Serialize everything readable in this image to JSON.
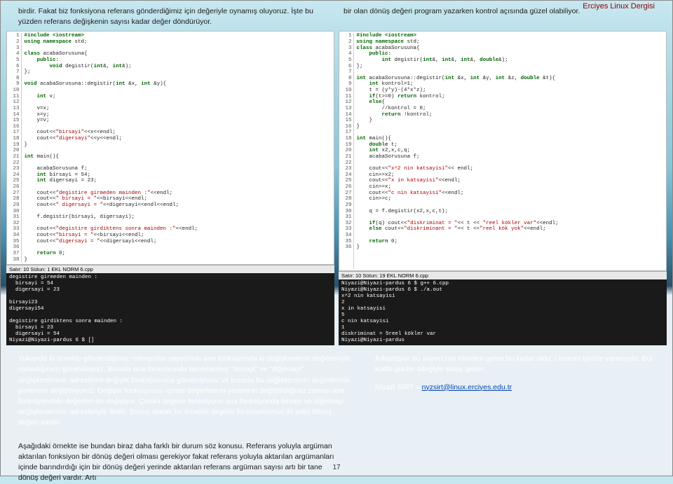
{
  "header": {
    "journal": "Erciyes Linux Dergisi"
  },
  "intro": {
    "left": "birdir. Fakat biz fonksiyona referans gönderdiğimiz için değeriyle oynamış oluyoruz. İşte bu yüzden referans değişkenin sayısı kadar değer döndürüyor.",
    "right": "bir olan dönüş değeri program yazarken kontrol açısında güzel olabiliyor."
  },
  "code_left": {
    "lines": 38,
    "status": "Satır: 10 Sütun: 1    EKL   NORM   6.cpp",
    "terminal": "degistire girmeden mainden :\n  birsayi = 54\n  digersayi = 23\n\nbirsayi23\ndigersayi54\n\ndegistire girdiktens sonra mainden :\n  birsayi = 23\n  digersayi = 54\nNiyazi@Niyazi-pardus 6 $ []"
  },
  "code_right": {
    "lines": 36,
    "status": "Satır: 10 Sütun: 19    EKL   NORM   6.cpp",
    "terminal": "Niyazi@Niyazi-pardus 6 $ g++ 6.cpp\nNiyazi@Niyazi-pardus 6 $ ./a.out\nx^2 nin katsayisi\n2\nx in katsayisi\n5\nc nin katsayisi\n1\ndiskriminat = 5reel kökler var\nNiyazi@Niyazi-pardus"
  },
  "middle": {
    "left": "Yukarıda ki örnekte gönderdiğimiz referanslar sayesinde ana fonksiyonda ki değişkenlerin değerleriyle oynadığımızı görebilirsiniz. Burada ana fonksiyonda tanımlanmış \"birsayi\" ve \"diğersayi\" değişkenlerinin adreslerini değiştir fonksiyonuna gönderiyoruz ve burada bu değişkenlerin değerlerinin yerlerinin değiştiriyoruz. Değiştir fonksiyonun içinde değerlerinin yerlerinin değiştirdiğimiz zaman ana fonksiyondaki değerleri de değişiyor. Çünkü degistir fonksiyonu ana fonksiyonda birsayi ve diğersayi değişkenlerinin adresleriyle ilintili. Sonuç olarak bu örnekte degistir fonksiyonunun iki adet dönüş değeri vardır.",
    "right": "Arkadaşlar bu sayımızda elimden gelen bu kadar oldu. Umarım işinize yaramıştır. Bol kodlu günler dileğiyle kolay gelsin.",
    "author": "Niyazi SIRT – ",
    "email": "nyzsirt@linux.erciyes.edu.tr"
  },
  "bottom": "Aşağıdaki örnekte ise bundan biraz daha farklı bir durum söz konusu. Referans yoluyla argüman aktarılan fonksiyon bir dönüş değeri olması gerekiyor fakat referans yoluyla aktarılan argümanları içinde barındırdığı için bir dönüş değeri yerinde aktarılan referans argüman sayısı artı bir tane dönüş değeri vardır. Artı",
  "page_number": "17"
}
